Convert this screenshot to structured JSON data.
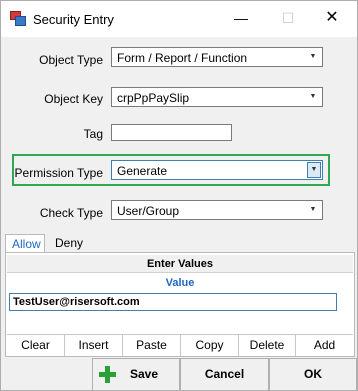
{
  "window": {
    "title": "Security Entry",
    "controls": {
      "minimize": "—",
      "maximize": "☐",
      "close": "✕"
    }
  },
  "form": {
    "object_type": {
      "label": "Object Type",
      "value": "Form / Report / Function"
    },
    "object_key": {
      "label": "Object Key",
      "value": "crpPpPaySlip"
    },
    "tag": {
      "label": "Tag",
      "value": ""
    },
    "permission_type": {
      "label": "Permission Type",
      "value": "Generate",
      "highlight_color": "#2fa84f"
    },
    "check_type": {
      "label": "Check Type",
      "value": "User/Group"
    }
  },
  "tabs": [
    {
      "label": "Allow",
      "selected": true
    },
    {
      "label": "Deny",
      "selected": false
    }
  ],
  "grid": {
    "title": "Enter Values",
    "column": "Value",
    "rows": [
      "TestUser@risersoft.com"
    ]
  },
  "grid_buttons": [
    "Clear",
    "Insert",
    "Paste",
    "Copy",
    "Delete",
    "Add"
  ],
  "dialog_buttons": {
    "save": "Save",
    "cancel": "Cancel",
    "ok": "OK"
  },
  "icons": {
    "app": "security-entry-app-icon",
    "save": "plus-icon",
    "dropdown": "chevron-down-icon"
  }
}
